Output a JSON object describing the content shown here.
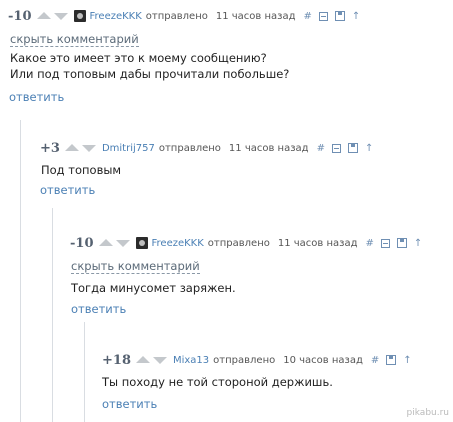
{
  "comments": [
    {
      "rating": "-10",
      "author": "FreezeKKK",
      "sent": "отправлено",
      "time": "11 часов назад",
      "hide": "скрыть комментарий",
      "text": "Какое это имеет это к моему сообщению?\nИли под топовым дабы прочитали побольше?",
      "reply": "ответить"
    },
    {
      "rating": "+3",
      "author": "Dmitrij757",
      "sent": "отправлено",
      "time": "11 часов назад",
      "text": "Под топовым",
      "reply": "ответить"
    },
    {
      "rating": "-10",
      "author": "FreezeKKK",
      "sent": "отправлено",
      "time": "11 часов назад",
      "hide": "скрыть комментарий",
      "text": "Тогда минусомет заряжен.",
      "reply": "ответить"
    },
    {
      "rating": "+18",
      "author": "Mixa13",
      "sent": "отправлено",
      "time": "10 часов назад",
      "text": "Ты походу не той стороной держишь.",
      "reply": "ответить"
    }
  ],
  "tools": {
    "hash": "#",
    "up": "↑"
  },
  "watermark": "pikabu.ru"
}
